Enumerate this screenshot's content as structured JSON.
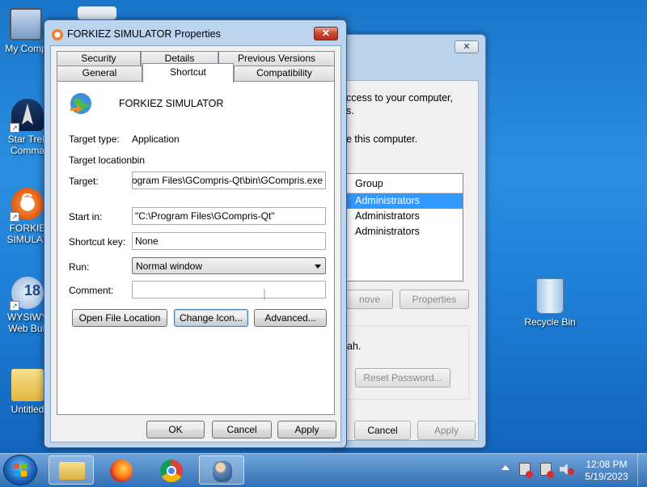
{
  "desktop": {
    "icons": [
      {
        "label": "My Comp"
      },
      {
        "label": "Star Trek Comma"
      },
      {
        "label": "FORKIE SIMULAT"
      },
      {
        "label": "WYSIWY Web Buil"
      },
      {
        "label": "Untitled"
      },
      {
        "label": "Recycle Bin"
      }
    ]
  },
  "back_window": {
    "text_1": "ccess to your computer,",
    "text_2": "s.",
    "text_3": "e this computer.",
    "list_header": "Group",
    "list_rows": [
      "Administrators",
      "Administrators",
      "Administrators"
    ],
    "remove_button": "nove",
    "properties_button": "Properties",
    "group_text": "ah.",
    "reset_password_button": "Reset Password...",
    "cancel_button": "Cancel",
    "apply_button": "Apply",
    "close_glyph": "✕"
  },
  "dialog": {
    "title": "FORKIEZ SIMULATOR Properties",
    "close_glyph": "✕",
    "tabs_row1": [
      "Security",
      "Details",
      "Previous Versions"
    ],
    "tabs_row2": [
      "General",
      "Shortcut",
      "Compatibility"
    ],
    "active_tab": "Shortcut",
    "app_name": "FORKIEZ SIMULATOR",
    "target_type_label": "Target type:",
    "target_type_value": "Application",
    "target_location_label": "Target location:",
    "target_location_value": "bin",
    "target_label": "Target:",
    "target_value": "C:\\Program Files\\GCompris-Qt\\bin\\GCompris.exe\"",
    "start_in_label": "Start in:",
    "start_in_value": "\"C:\\Program Files\\GCompris-Qt\"",
    "shortcut_key_label": "Shortcut key:",
    "shortcut_key_value": "None",
    "run_label": "Run:",
    "run_value": "Normal window",
    "comment_label": "Comment:",
    "comment_value": "",
    "open_file_location_button": "Open File Location",
    "change_icon_button": "Change Icon...",
    "advanced_button": "Advanced...",
    "ok_button": "OK",
    "cancel_button": "Cancel",
    "apply_button": "Apply"
  },
  "taskbar": {
    "time": "12:08 PM",
    "date": "5/19/2023",
    "pinned": [
      "windows-explorer",
      "firefox",
      "chrome",
      "user-accounts"
    ]
  }
}
